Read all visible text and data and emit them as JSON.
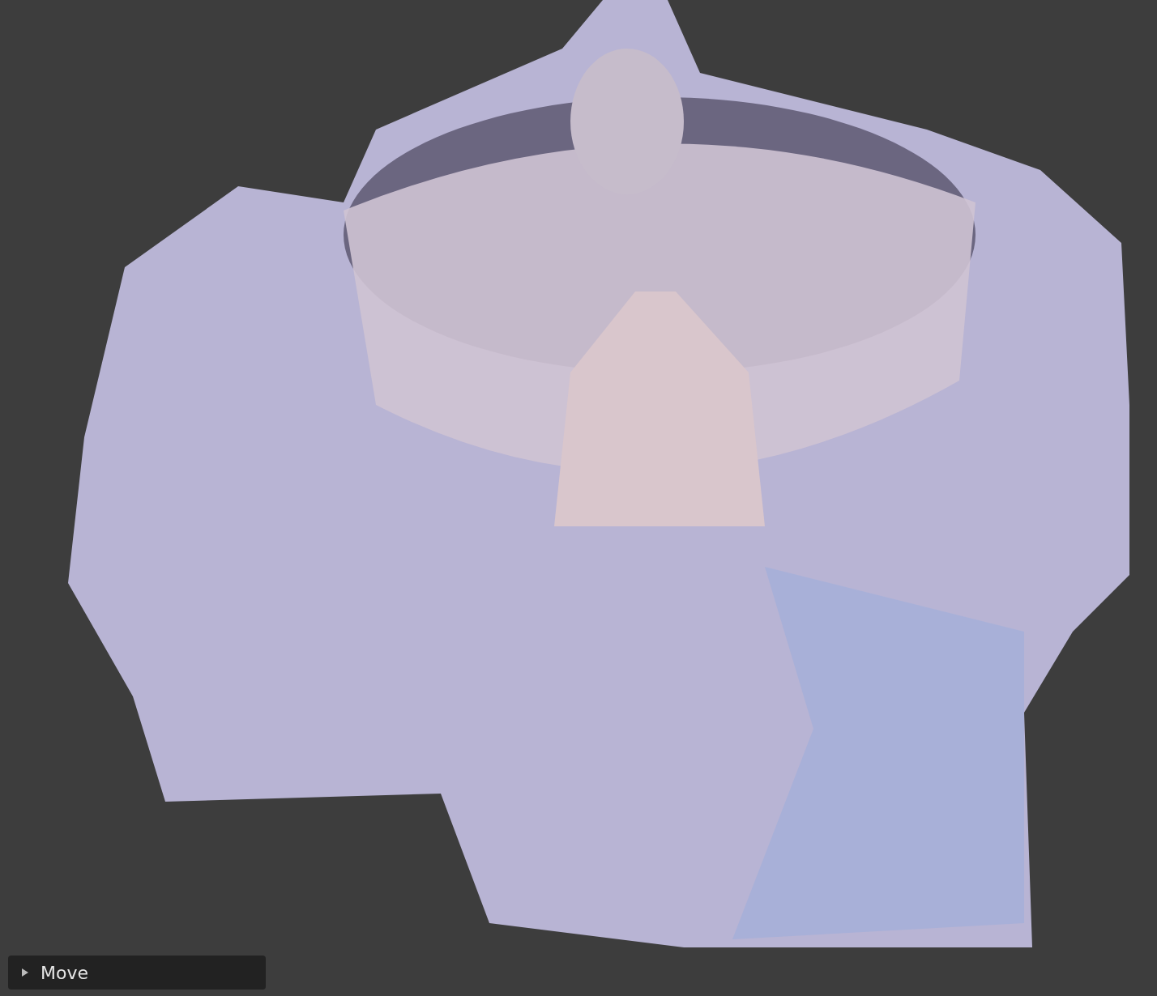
{
  "viewport": {
    "operator_panel": {
      "label": "Move",
      "expanded": false
    }
  }
}
